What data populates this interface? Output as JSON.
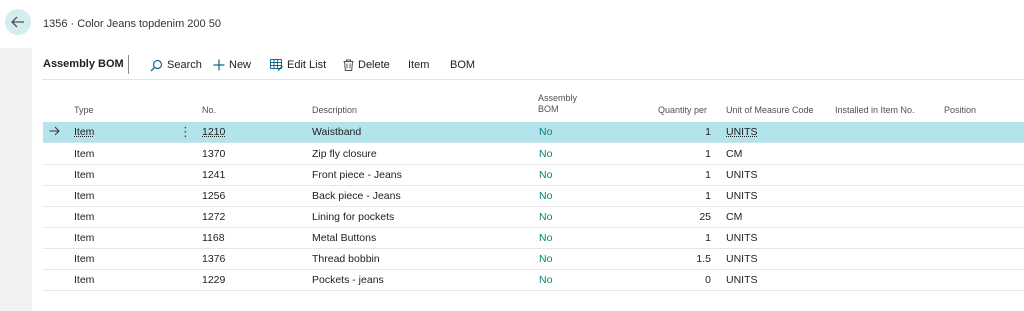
{
  "page": {
    "title": "1356 · Color Jeans topdenim 200 50"
  },
  "part": {
    "title": "Assembly BOM"
  },
  "actions": {
    "search": "Search",
    "new": "New",
    "edit_list": "Edit List",
    "delete": "Delete",
    "item": "Item",
    "bom": "BOM"
  },
  "columns": {
    "type": "Type",
    "no": "No.",
    "description": "Description",
    "assembly_bom_1": "Assembly",
    "assembly_bom_2": "BOM",
    "quantity_per": "Quantity per",
    "uom": "Unit of Measure Code",
    "installed_in": "Installed in Item No.",
    "position": "Position"
  },
  "rows": [
    {
      "type": "Item",
      "no": "1210",
      "description": "Waistband",
      "assembly_bom": "No",
      "quantity_per": "1",
      "uom": "UNITS"
    },
    {
      "type": "Item",
      "no": "1370",
      "description": "Zip fly closure",
      "assembly_bom": "No",
      "quantity_per": "1",
      "uom": "CM"
    },
    {
      "type": "Item",
      "no": "1241",
      "description": "Front piece - Jeans",
      "assembly_bom": "No",
      "quantity_per": "1",
      "uom": "UNITS"
    },
    {
      "type": "Item",
      "no": "1256",
      "description": "Back piece - Jeans",
      "assembly_bom": "No",
      "quantity_per": "1",
      "uom": "UNITS"
    },
    {
      "type": "Item",
      "no": "1272",
      "description": "Lining for pockets",
      "assembly_bom": "No",
      "quantity_per": "25",
      "uom": "CM"
    },
    {
      "type": "Item",
      "no": "1168",
      "description": "Metal Buttons",
      "assembly_bom": "No",
      "quantity_per": "1",
      "uom": "UNITS"
    },
    {
      "type": "Item",
      "no": "1376",
      "description": "Thread bobbin",
      "assembly_bom": "No",
      "quantity_per": "1.5",
      "uom": "UNITS"
    },
    {
      "type": "Item",
      "no": "1229",
      "description": "Pockets - jeans",
      "assembly_bom": "No",
      "quantity_per": "0",
      "uom": "UNITS"
    }
  ],
  "colors": {
    "selected_row": "#b4e4eb",
    "no_value": "#00857a",
    "accent": "#00857a"
  },
  "icons": {
    "back": "back-arrow-icon",
    "search": "search-icon",
    "new": "plus-icon",
    "edit_list": "edit-list-icon",
    "delete": "trash-icon",
    "row_selected": "row-arrow-icon",
    "row_menu": "more-vertical-icon"
  }
}
